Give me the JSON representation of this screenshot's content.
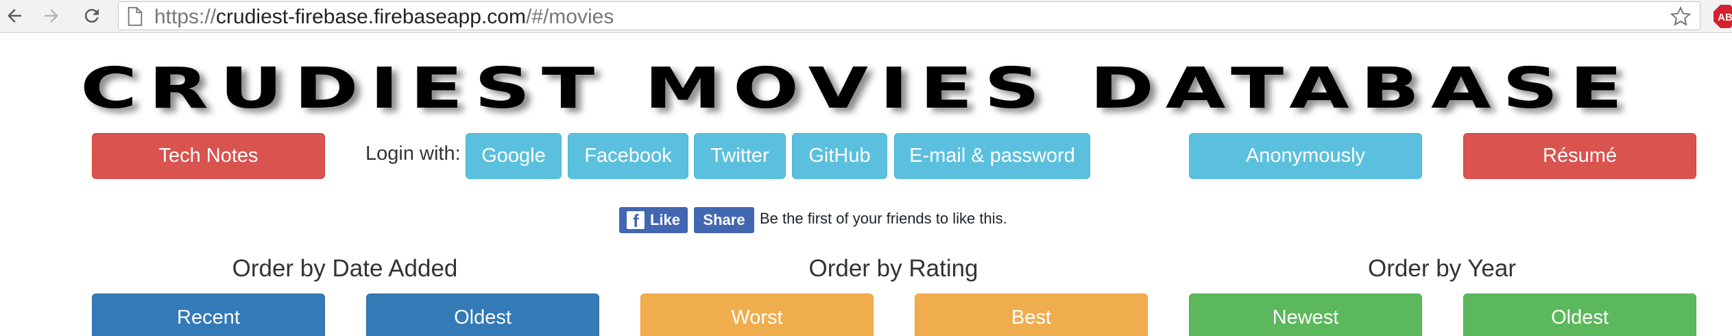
{
  "browser": {
    "url_scheme": "https://",
    "url_host": "crudiest-firebase.firebaseapp.com",
    "url_path": "/#/movies",
    "extension_badge": "AB"
  },
  "header": {
    "title": "CRUDIEST MOVIES DATABASE"
  },
  "toolbar": {
    "tech_notes": "Tech Notes",
    "login_label": "Login with:",
    "login_google": "Google",
    "login_facebook": "Facebook",
    "login_twitter": "Twitter",
    "login_github": "GitHub",
    "login_email": "E-mail & password",
    "login_anonymous": "Anonymously",
    "resume": "Résumé"
  },
  "facebook": {
    "like": "Like",
    "share": "Share",
    "social_text": "Be the first of your friends to like this."
  },
  "sort": {
    "date_title": "Order by Date Added",
    "date_recent": "Recent",
    "date_oldest": "Oldest",
    "rating_title": "Order by Rating",
    "rating_worst": "Worst",
    "rating_best": "Best",
    "year_title": "Order by Year",
    "year_newest": "Newest",
    "year_oldest": "Oldest"
  },
  "colors": {
    "danger": "#d9534f",
    "info": "#5bc0de",
    "primary": "#337ab7",
    "warning": "#f0ad4e",
    "success": "#5cb85c",
    "facebook": "#4267b2"
  },
  "icons": [
    "back-arrow-icon",
    "forward-arrow-icon",
    "reload-icon",
    "page-icon",
    "bookmark-star-icon",
    "adblock-icon",
    "facebook-logo-icon"
  ]
}
